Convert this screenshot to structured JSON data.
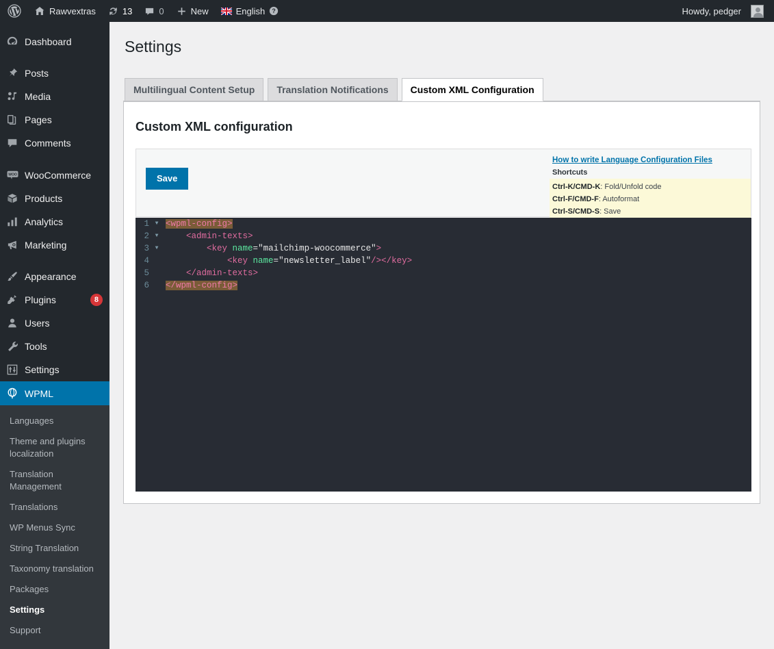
{
  "adminbar": {
    "logo_icon": "wordpress-logo-icon",
    "site_icon": "home-icon",
    "site_name": "Rawvextras",
    "updates_icon": "updates-icon",
    "updates_count": "13",
    "comments_icon": "comments-icon",
    "comments_count": "0",
    "new_icon": "plus-icon",
    "new_label": "New",
    "language_flag": "uk-flag-icon",
    "language_label": "English",
    "language_help_icon": "help-icon",
    "howdy": "Howdy, pedger",
    "avatar": "user-avatar"
  },
  "sidebar": {
    "items": [
      {
        "label": "Dashboard",
        "icon": "dashboard-icon",
        "badge": ""
      },
      {
        "label": "Posts",
        "icon": "pin-icon",
        "badge": ""
      },
      {
        "label": "Media",
        "icon": "media-icon",
        "badge": ""
      },
      {
        "label": "Pages",
        "icon": "pages-icon",
        "badge": ""
      },
      {
        "label": "Comments",
        "icon": "comment-icon",
        "badge": ""
      },
      {
        "label": "WooCommerce",
        "icon": "woocommerce-icon",
        "badge": ""
      },
      {
        "label": "Products",
        "icon": "products-box-icon",
        "badge": ""
      },
      {
        "label": "Analytics",
        "icon": "analytics-bars-icon",
        "badge": ""
      },
      {
        "label": "Marketing",
        "icon": "megaphone-icon",
        "badge": ""
      },
      {
        "label": "Appearance",
        "icon": "paintbrush-icon",
        "badge": ""
      },
      {
        "label": "Plugins",
        "icon": "plug-icon",
        "badge": "8"
      },
      {
        "label": "Users",
        "icon": "user-icon",
        "badge": ""
      },
      {
        "label": "Tools",
        "icon": "wrench-icon",
        "badge": ""
      },
      {
        "label": "Settings",
        "icon": "settings-sliders-icon",
        "badge": ""
      },
      {
        "label": "WPML",
        "icon": "wpml-icon",
        "badge": ""
      }
    ],
    "submenu": [
      "Languages",
      "Theme and plugins localization",
      "Translation Management",
      "Translations",
      "WP Menus Sync",
      "String Translation",
      "Taxonomy translation",
      "Packages",
      "Settings",
      "Support"
    ],
    "submenu_current": "Settings",
    "current_item": "WPML",
    "accent_color": "#0073aa",
    "badge_color": "#d63638"
  },
  "main": {
    "page_title": "Settings",
    "tabs": [
      {
        "label": "Multilingual Content Setup",
        "active": false
      },
      {
        "label": "Translation Notifications",
        "active": false
      },
      {
        "label": "Custom XML Configuration",
        "active": true
      }
    ],
    "card_title": "Custom XML configuration",
    "save_label": "Save",
    "help_link": "How to write Language Configuration Files",
    "shortcuts_title": "Shortcuts",
    "shortcuts": [
      {
        "key": "Ctrl-K/CMD-K",
        "desc": ": Fold/Unfold code"
      },
      {
        "key": "Ctrl-F/CMD-F",
        "desc": ": Autoformat"
      },
      {
        "key": "Ctrl-S/CMD-S",
        "desc": ": Save"
      }
    ],
    "shortcut_bg": "#fcf9d8",
    "editor": {
      "background": "#282c34",
      "lines": [
        {
          "number": "1",
          "foldable": true,
          "indent": 0,
          "tokens": [
            {
              "t": "<wpml-config>",
              "c": "tok-tag-hl"
            }
          ]
        },
        {
          "number": "2",
          "foldable": true,
          "indent": 4,
          "tokens": [
            {
              "t": "<admin-texts>",
              "c": "tok-tag"
            }
          ]
        },
        {
          "number": "3",
          "foldable": true,
          "indent": 8,
          "tokens": [
            {
              "t": "<key ",
              "c": "tok-tag"
            },
            {
              "t": "name",
              "c": "tok-attr"
            },
            {
              "t": "=",
              "c": "tok-eq"
            },
            {
              "t": "\"mailchimp-woocommerce\"",
              "c": "tok-str"
            },
            {
              "t": ">",
              "c": "tok-tag"
            }
          ]
        },
        {
          "number": "4",
          "foldable": false,
          "indent": 12,
          "tokens": [
            {
              "t": "<key ",
              "c": "tok-tag"
            },
            {
              "t": "name",
              "c": "tok-attr"
            },
            {
              "t": "=",
              "c": "tok-eq"
            },
            {
              "t": "\"newsletter_label\"",
              "c": "tok-str"
            },
            {
              "t": "/>",
              "c": "tok-tag"
            },
            {
              "t": "</key>",
              "c": "tok-tag"
            }
          ]
        },
        {
          "number": "5",
          "foldable": false,
          "indent": 4,
          "tokens": [
            {
              "t": "</admin-texts>",
              "c": "tok-tag"
            }
          ]
        },
        {
          "number": "6",
          "foldable": false,
          "indent": 0,
          "tokens": [
            {
              "t": "</wpml-config>",
              "c": "tok-tag-hl"
            }
          ]
        }
      ]
    }
  }
}
